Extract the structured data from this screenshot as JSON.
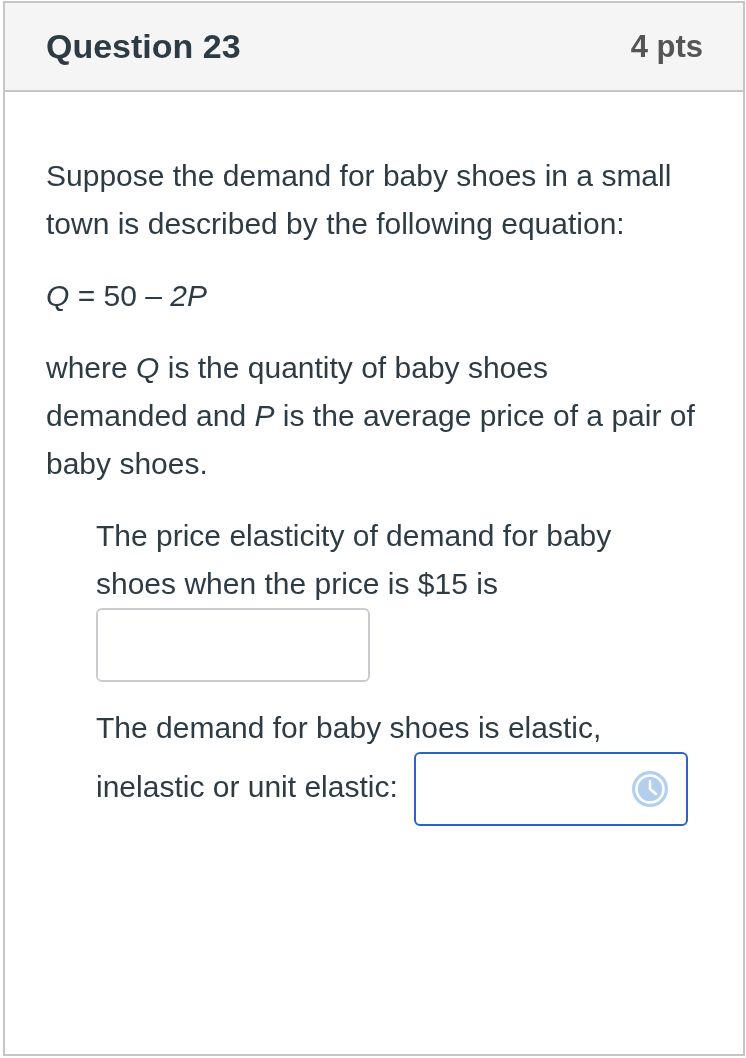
{
  "header": {
    "title": "Question 23",
    "points": "4 pts"
  },
  "paragraphs": [
    {
      "text": "Suppose the demand for baby shoes in a small town is described by the following equation:"
    },
    {
      "text": "*Q* = 50 – *2P*"
    },
    {
      "text": "where *Q* is the quantity of baby shoes demanded and *P* is the average price of a pair of baby shoes."
    }
  ],
  "questions": [
    {
      "kind": "text_input",
      "prompt": "The price elasticity of demand for baby shoes when the price is $15 is",
      "focused": false
    },
    {
      "kind": "dropdown",
      "prompt": "The demand for baby shoes is elastic, inelastic or unit elastic:",
      "focused": true
    }
  ]
}
